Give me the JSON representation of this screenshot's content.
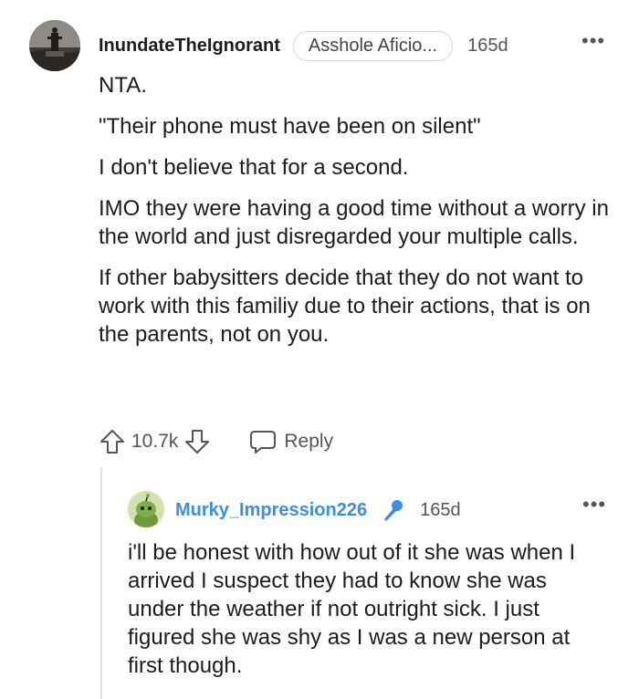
{
  "comment": {
    "username": "InundateTheIgnorant",
    "flair": "Asshole Aficio...",
    "age": "165d",
    "more": "•••",
    "paragraphs": [
      "NTA.",
      "\"Their phone must have been on silent\"",
      "I don't believe that for a second.",
      "IMO they were having a good time without a worry in the world and just disregarded your multiple calls.",
      "If other babysitters decide that they do not want to work with this familiy due to their actions, that is on the parents, not on you."
    ],
    "score": "10.7k",
    "reply_label": "Reply"
  },
  "reply": {
    "username": "Murky_Impression226",
    "age": "165d",
    "more": "•••",
    "text": "i'll be honest with how out of it she was when I arrived I suspect they had to know she was under the weather if not outright sick. I just figured she was shy as I was a new person at first though."
  },
  "colors": {
    "reply_username": "#3d8ee1",
    "mic_icon": "#3d8ee1",
    "text": "#1c1c1c",
    "meta": "#555555"
  }
}
